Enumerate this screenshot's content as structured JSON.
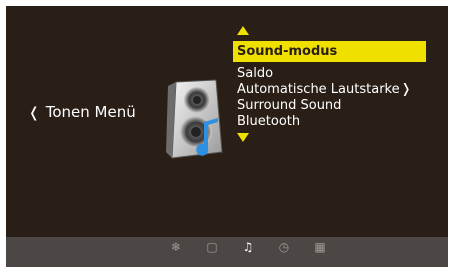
{
  "back": {
    "chevron": "❬",
    "label": "Tonen Menü"
  },
  "menu": {
    "selected": "Sound-modus",
    "items": [
      {
        "label": "Saldo"
      },
      {
        "label": "Automatische Lautstarke",
        "next": "❭"
      },
      {
        "label": "Surround Sound"
      },
      {
        "label": "Bluetooth"
      }
    ]
  },
  "nav": {
    "icons": [
      {
        "name": "settings-icon",
        "glyph": "❄"
      },
      {
        "name": "picture-icon",
        "glyph": "▢"
      },
      {
        "name": "sound-icon",
        "glyph": "♫"
      },
      {
        "name": "clock-icon",
        "glyph": "◷"
      },
      {
        "name": "apps-icon",
        "glyph": "▦"
      }
    ],
    "active_index": 2
  },
  "colors": {
    "accent": "#f0e000",
    "background": "#2a1f16",
    "bar": "#4c4745"
  }
}
